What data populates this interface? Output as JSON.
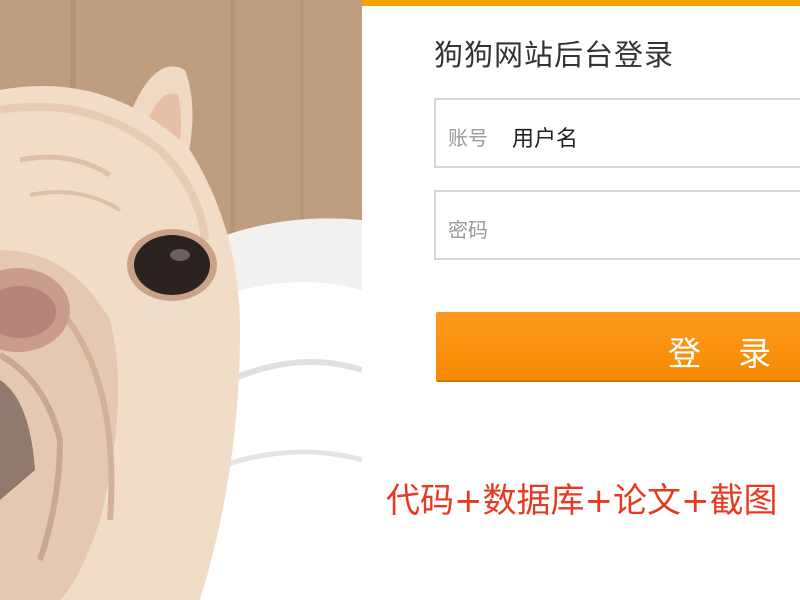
{
  "login": {
    "title": "狗狗网站后台登录",
    "username": {
      "label": "账号",
      "value": "用户名"
    },
    "password": {
      "label": "密码",
      "value": ""
    },
    "submit_label": "登 录"
  },
  "promo": {
    "text": "代码+数据库+论文+截图"
  },
  "colors": {
    "accent": "#f5a100",
    "button": "#f68a00",
    "promo_text": "#e83a22"
  },
  "photo": {
    "subject": "french-bulldog-photo"
  }
}
